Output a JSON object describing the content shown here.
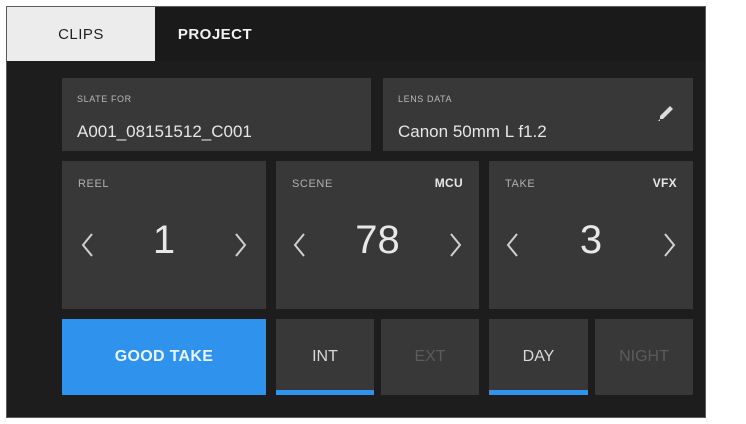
{
  "tabs": [
    {
      "label": "CLIPS",
      "active": true
    },
    {
      "label": "PROJECT",
      "active": false
    }
  ],
  "slate_for": {
    "label": "SLATE FOR",
    "value": "A001_08151512_C001"
  },
  "lens_data": {
    "label": "LENS DATA",
    "value": "Canon 50mm L f1.2",
    "icon": "pencil-icon"
  },
  "reel": {
    "label": "REEL",
    "value": "1",
    "tag": ""
  },
  "scene": {
    "label": "SCENE",
    "value": "78",
    "tag": "MCU"
  },
  "take": {
    "label": "TAKE",
    "value": "3",
    "tag": "VFX"
  },
  "buttons": {
    "good_take": "GOOD TAKE",
    "int": "INT",
    "ext": "EXT",
    "day": "DAY",
    "night": "NIGHT"
  },
  "selected": {
    "int_ext": "INT",
    "day_night": "DAY"
  },
  "colors": {
    "accent": "#2f93ee",
    "panel": "#383838",
    "background": "#1d1d1d"
  }
}
